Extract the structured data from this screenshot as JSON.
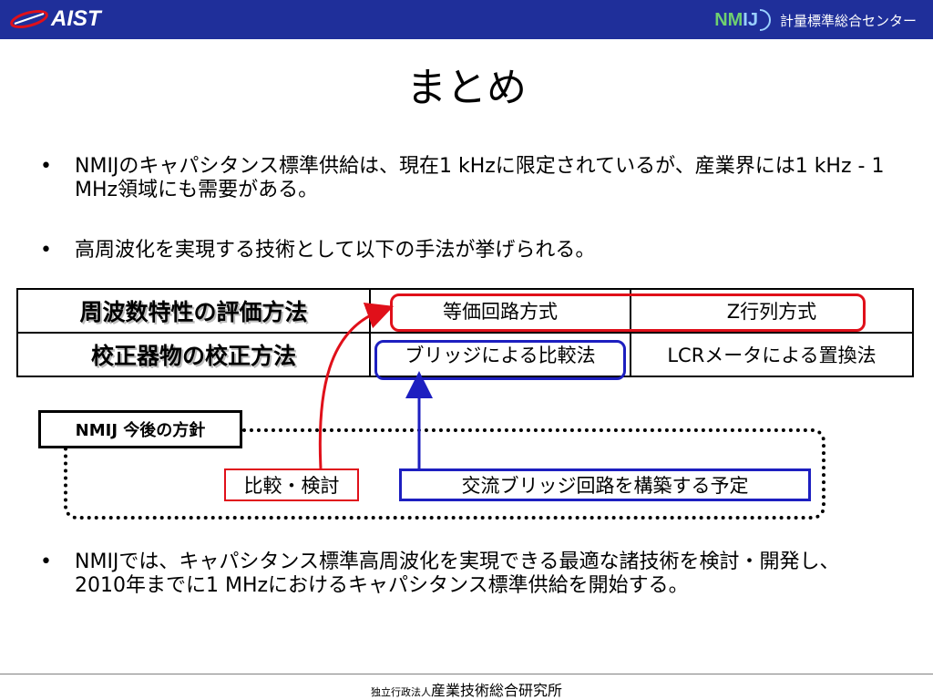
{
  "header": {
    "left_logo": "AIST",
    "right_logo_mark": "NMIJ",
    "right_logo_text": "計量標準総合センター"
  },
  "slide": {
    "title": "まとめ",
    "bullet_char": "•",
    "bullets": [
      "NMIJのキャパシタンス標準供給は、現在1 kHzに限定されているが、産業界には1 kHz - 1 MHz領域にも需要がある。",
      "高周波化を実現する技術として以下の手法が挙げられる。",
      "NMIJでは、キャパシタンス標準高周波化を実現できる最適な諸技術を検討・開発し、2010年までに1 MHzにおけるキャパシタンス標準供給を開始する。"
    ],
    "table": {
      "rows": [
        {
          "header": "周波数特性の評価方法",
          "cells": [
            "等価回路方式",
            "Z行列方式"
          ]
        },
        {
          "header": "校正器物の校正方法",
          "cells": [
            "ブリッジによる比較法",
            "LCRメータによる置換法"
          ]
        }
      ]
    },
    "policy": {
      "title": "NMIJ 今後の方針",
      "red_label": "比較・検討",
      "blue_label": "交流ブリッジ回路を構築する予定"
    },
    "colors": {
      "header_bg": "#1f2f9a",
      "red": "#e0101a",
      "blue": "#1d1fc0"
    }
  },
  "footer": {
    "prefix": "独立行政法人",
    "org": "産業技術総合研究所"
  }
}
